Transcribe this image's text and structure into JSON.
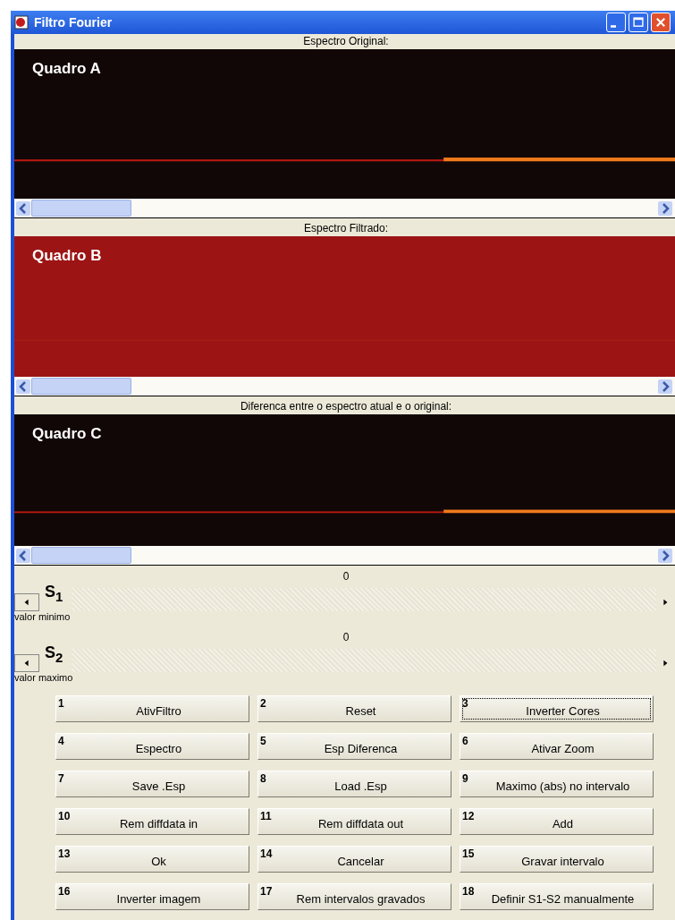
{
  "window": {
    "title": "Filtro Fourier"
  },
  "panels": [
    {
      "label": "Espectro Original:",
      "frame": "Quadro A",
      "color": "#120707",
      "kind": "bright"
    },
    {
      "label": "Espectro Filtrado:",
      "frame": "Quadro B",
      "color": "#9c1414",
      "kind": "faint"
    },
    {
      "label": "Diferenca entre o espectro atual e o original:",
      "frame": "Quadro C",
      "color": "#120707",
      "kind": "bright"
    }
  ],
  "sliders": [
    {
      "name": "S$_{1}$",
      "value": "0",
      "caption": "valor minimo"
    },
    {
      "name": "S$_{2}$",
      "value": "0",
      "caption": "valor maximo"
    }
  ],
  "buttons": [
    {
      "number": "1",
      "label": "AtivFiltro",
      "focused": false
    },
    {
      "number": "2",
      "label": "Reset",
      "focused": false
    },
    {
      "number": "3",
      "label": "Inverter Cores",
      "focused": true
    },
    {
      "number": "4",
      "label": "Espectro",
      "focused": false
    },
    {
      "number": "5",
      "label": "Esp Diferenca",
      "focused": false
    },
    {
      "number": "6",
      "label": "Ativar Zoom",
      "focused": false
    },
    {
      "number": "7",
      "label": "Save .Esp",
      "focused": false
    },
    {
      "number": "8",
      "label": "Load .Esp",
      "focused": false
    },
    {
      "number": "9",
      "label": "Maximo (abs) no intervalo",
      "focused": false
    },
    {
      "number": "10",
      "label": "Rem diffdata in",
      "focused": false
    },
    {
      "number": "11",
      "label": "Rem diffdata out",
      "focused": false
    },
    {
      "number": "12",
      "label": "Add",
      "focused": false
    },
    {
      "number": "13",
      "label": "Ok",
      "focused": false
    },
    {
      "number": "14",
      "label": "Cancelar",
      "focused": false
    },
    {
      "number": "15",
      "label": "Gravar intervalo",
      "focused": false
    },
    {
      "number": "16",
      "label": "Inverter imagem",
      "focused": false
    },
    {
      "number": "17",
      "label": "Rem intervalos gravados",
      "focused": false
    },
    {
      "number": "18",
      "label": "Definir S1-S2 manualmente",
      "focused": false
    }
  ]
}
